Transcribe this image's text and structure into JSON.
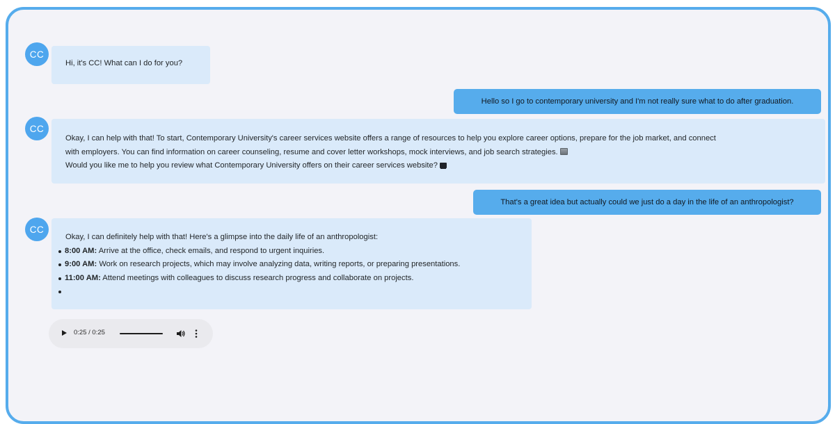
{
  "chat": {
    "messages": [
      {
        "role": "assistant",
        "avatar": "CC",
        "text": "Hi, it's CC! What can I do for you?"
      },
      {
        "role": "user",
        "text": "Hello so I go to contemporary university and I'm not really sure what to do after graduation."
      },
      {
        "role": "assistant",
        "avatar": "CC",
        "line1": "Okay, I can help with that! To start, Contemporary University's career services website offers a range of resources to help you explore career options, prepare for the job market, and connect",
        "line2": "with employers. You can find information on career counseling, resume and cover letter workshops, mock interviews, and job search strategies.",
        "line2_icon": "camera-icon",
        "line3": "Would you like me to help you review what Contemporary University offers on their career services website?",
        "line3_icon": "laptop-icon"
      },
      {
        "role": "user",
        "text": "That's a great idea but actually could we just do a day in the life of an anthropologist?"
      },
      {
        "role": "assistant",
        "avatar": "CC",
        "intro": "Okay, I can definitely help with that! Here's a glimpse into the daily life of an anthropologist:",
        "schedule": [
          {
            "time": "8:00 AM:",
            "text": " Arrive at the office, check emails, and respond to urgent inquiries."
          },
          {
            "time": "9:00 AM:",
            "text": " Work on research projects, which may involve analyzing data, writing reports, or preparing presentations."
          },
          {
            "time": "11:00 AM:",
            "text": " Attend meetings with colleagues to discuss research progress and collaborate on projects."
          },
          {
            "time": "",
            "text": ""
          }
        ]
      }
    ]
  },
  "audio_player": {
    "time_display": "0:25 / 0:25",
    "progress": 1.0,
    "play_icon": "play-icon",
    "volume_icon": "volume-icon",
    "menu_icon": "more-vertical-icon"
  },
  "colors": {
    "frame_border": "#56acec",
    "background": "#f3f3f8",
    "assistant_bubble": "#daeafa",
    "user_bubble": "#56acec",
    "avatar": "#4ea6ee"
  }
}
